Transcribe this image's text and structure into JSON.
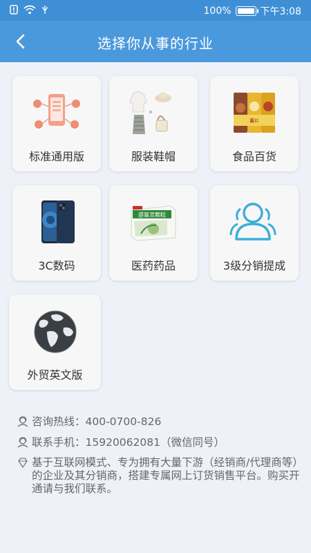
{
  "status": {
    "battery_pct": "100%",
    "battery_level": 1.0,
    "time": "下午3:08"
  },
  "header": {
    "title": "选择你从事的行业"
  },
  "categories": [
    {
      "label": "标准通用版",
      "icon": "phone-network-icon"
    },
    {
      "label": "服装鞋帽",
      "icon": "clothing-icon"
    },
    {
      "label": "食品百货",
      "icon": "snack-icon"
    },
    {
      "label": "3C数码",
      "icon": "smartphone-icon"
    },
    {
      "label": "医药药品",
      "icon": "medicine-box-icon"
    },
    {
      "label": "3级分销提成",
      "icon": "users-icon"
    },
    {
      "label": "外贸英文版",
      "icon": "globe-icon"
    }
  ],
  "contact": {
    "hotline": "咨询热线：400-0700-826",
    "mobile": "联系手机：15920062081（微信同号）",
    "desc": "基于互联网模式、专为拥有大量下游（经销商/代理商等）的企业及其分销商，搭建专属网上订货销售平台。购买开通请与我们联系。"
  },
  "product_text": {
    "medicine_box": "感冒灵颗粒"
  },
  "colors": {
    "statusbar": "#3f8fd6",
    "titlebar": "#4b99dd",
    "background": "#eef2f8",
    "accent": "#3aaed8"
  }
}
